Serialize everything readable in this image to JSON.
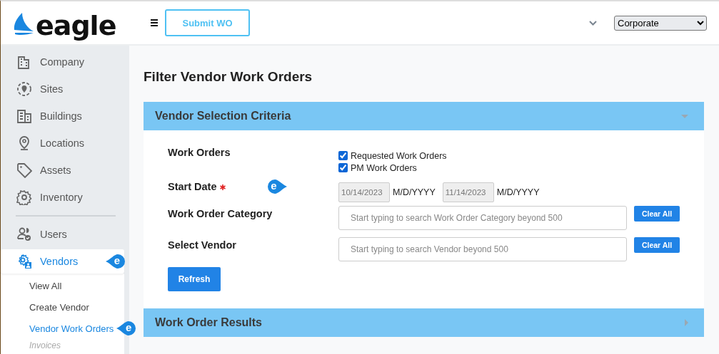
{
  "header": {
    "logo_text": "eagle",
    "submit_button": "Submit WO",
    "site_select": {
      "value": "Corporate"
    }
  },
  "sidebar": {
    "items": [
      {
        "label": "Company",
        "selected": false
      },
      {
        "label": "Sites",
        "selected": false
      },
      {
        "label": "Buildings",
        "selected": false
      },
      {
        "label": "Locations",
        "selected": false
      },
      {
        "label": "Assets",
        "selected": false
      },
      {
        "label": "Inventory",
        "selected": false,
        "divider_after": true
      },
      {
        "label": "Users",
        "selected": false
      },
      {
        "label": "Vendors",
        "selected": true,
        "badge": "e",
        "children": [
          {
            "label": "View All",
            "selected": false
          },
          {
            "label": "Create Vendor",
            "selected": false
          },
          {
            "label": "Vendor Work Orders",
            "selected": true,
            "badge": "e"
          },
          {
            "label": "Invoices",
            "selected": false,
            "disabled": true
          }
        ]
      }
    ]
  },
  "page": {
    "title": "Filter Vendor Work Orders",
    "criteria_panel": {
      "title": "Vendor Selection Criteria",
      "expanded": true,
      "work_orders": {
        "label": "Work Orders",
        "options": [
          {
            "label": "Requested Work Orders",
            "checked": true
          },
          {
            "label": "PM Work Orders",
            "checked": true
          }
        ]
      },
      "start_date": {
        "label": "Start Date",
        "required": true,
        "badge": "e",
        "from": {
          "value": "10/14/2023",
          "format": "M/D/YYYY"
        },
        "to": {
          "value": "11/14/2023",
          "format": "M/D/YYYY"
        }
      },
      "category": {
        "label": "Work Order Category",
        "placeholder": "Start typing to search Work Order Category beyond 500",
        "clear_button": "Clear All"
      },
      "vendor": {
        "label": "Select Vendor",
        "placeholder": "Start typing to search Vendor beyond 500",
        "clear_button": "Clear All"
      },
      "refresh_button": "Refresh"
    },
    "results_panel": {
      "title": "Work Order Results",
      "expanded": false
    }
  }
}
